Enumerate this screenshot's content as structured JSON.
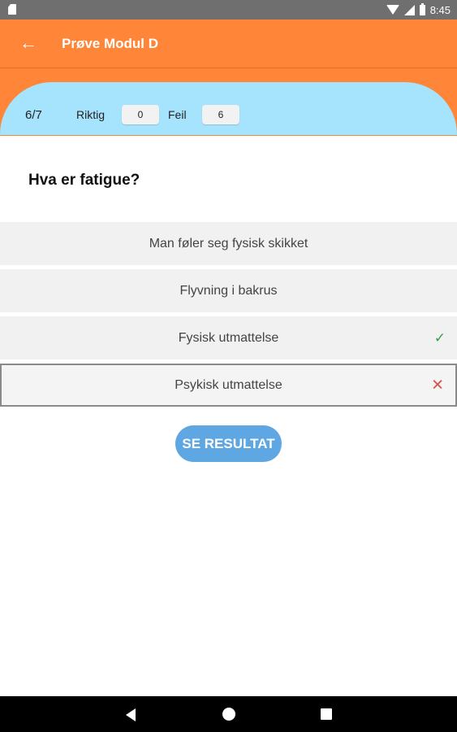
{
  "status_bar": {
    "time": "8:45",
    "icons": [
      "sd-card-icon",
      "wifi-icon",
      "signal-icon",
      "battery-icon"
    ]
  },
  "app_bar": {
    "title": "Prøve Modul D",
    "back_icon": "arrow-left-icon"
  },
  "score": {
    "counter": "6/7",
    "correct_label": "Riktig",
    "correct_value": "0",
    "wrong_label": "Feil",
    "wrong_value": "6"
  },
  "question": {
    "text": "Hva er fatigue?"
  },
  "answers": [
    {
      "label": "Man føler seg fysisk skikket",
      "status": "none"
    },
    {
      "label": "Flyvning i bakrus",
      "status": "none"
    },
    {
      "label": "Fysisk utmattelse",
      "status": "correct"
    },
    {
      "label": "Psykisk utmattelse",
      "status": "wrong"
    }
  ],
  "result_button": {
    "label": "SE RESULTAT"
  },
  "colors": {
    "app_bar": "#ff8539",
    "score_band": "#a6e3fc",
    "button": "#5ea7e3",
    "correct": "#3c9b4b",
    "wrong": "#d9534f"
  },
  "nav_bar": {
    "icons": [
      "back-triangle-icon",
      "home-circle-icon",
      "recents-square-icon"
    ]
  }
}
